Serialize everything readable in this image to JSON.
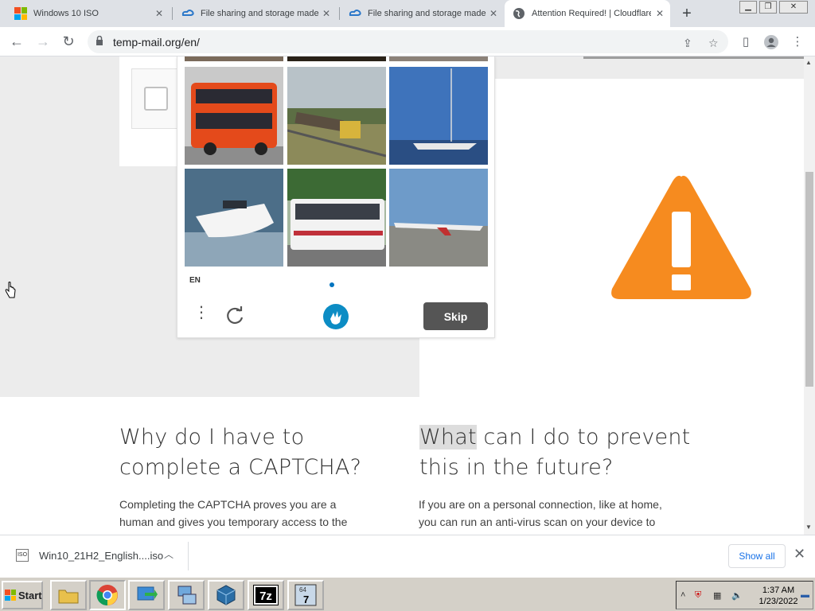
{
  "browser": {
    "tabs": [
      {
        "title": "Windows 10 ISO",
        "icon": "windows-icon",
        "active": false
      },
      {
        "title": "File sharing and storage made",
        "icon": "cloud-icon",
        "active": false
      },
      {
        "title": "File sharing and storage made",
        "icon": "cloud-icon",
        "active": false
      },
      {
        "title": "Attention Required! | Cloudflare",
        "icon": "globe-icon",
        "active": true
      }
    ],
    "url": "temp-mail.org/en/"
  },
  "captcha": {
    "language": "EN",
    "skip_label": "Skip"
  },
  "page": {
    "heading_left_line1": "Why do I have to",
    "heading_left_line2": "complete a CAPTCHA?",
    "heading_right_line1_highlight": "What",
    "heading_right_line1_rest": " can I do to prevent",
    "heading_right_line2": "this in the future?",
    "para_left_line1": "Completing the CAPTCHA proves you are a",
    "para_left_line2": "human and gives you temporary access to the",
    "para_right_line1": "If you are on a personal connection, like at home,",
    "para_right_line2": "you can run an anti-virus scan on your device to"
  },
  "download_bar": {
    "filename": "Win10_21H2_English....iso",
    "show_all": "Show all"
  },
  "taskbar": {
    "start_label": "Start",
    "time": "1:37 AM",
    "date": "1/23/2022"
  },
  "colors": {
    "warning": "#f68b1f",
    "skip_button": "#555555",
    "hcaptcha_accent": "#0074bf"
  }
}
